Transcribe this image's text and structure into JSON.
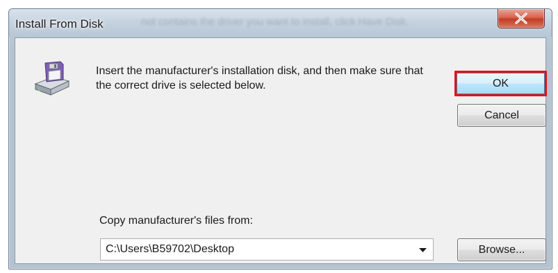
{
  "window": {
    "title": "Install From Disk",
    "background_text": "not contains the driver you want to install, click Have Disk."
  },
  "message": {
    "text": "Insert the manufacturer's installation disk, and then make sure that the correct drive is selected below."
  },
  "buttons": {
    "ok_label": "OK",
    "cancel_label": "Cancel",
    "browse_label": "Browse..."
  },
  "copy_from": {
    "label": "Copy manufacturer's files from:",
    "path_value": "C:\\Users\\B59702\\Desktop"
  },
  "icons": {
    "dialog_icon": "floppy-disk-drive-icon",
    "close_icon": "close-icon",
    "dropdown_icon": "chevron-down-icon"
  },
  "colors": {
    "highlight_border": "#e81010",
    "close_button": "#c94a34",
    "dialog_background": "#f0f0f0"
  }
}
